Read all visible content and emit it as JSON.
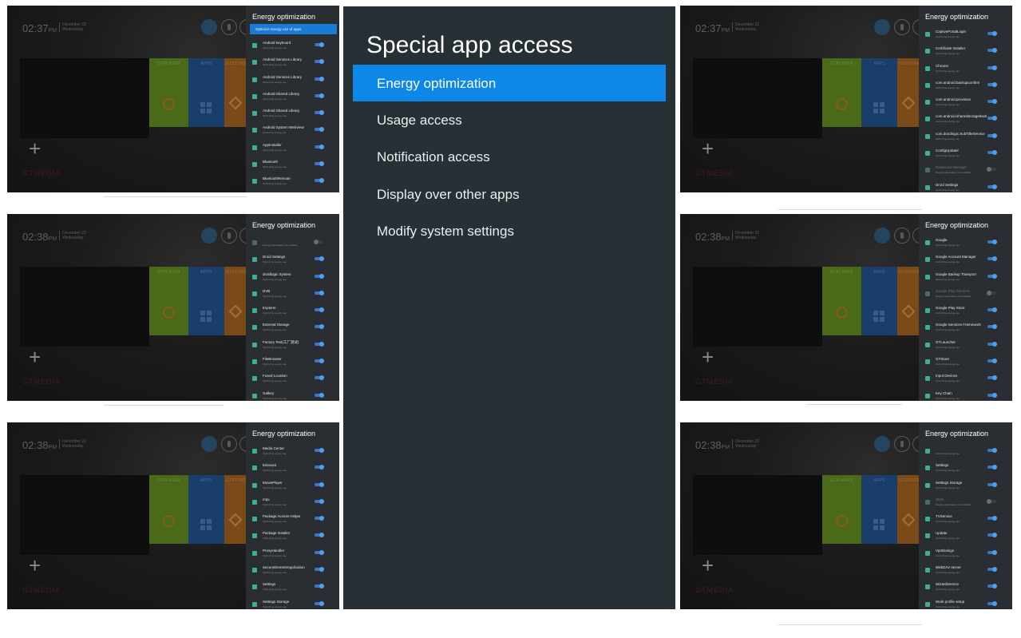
{
  "main": {
    "title": "Special app access",
    "items": [
      {
        "label": "Energy optimization",
        "selected": true
      },
      {
        "label": "Usage access",
        "selected": false
      },
      {
        "label": "Notification access",
        "selected": false
      },
      {
        "label": "Display over other apps",
        "selected": false
      },
      {
        "label": "Modify system settings",
        "selected": false
      }
    ]
  },
  "panel_title": "Energy optimization",
  "panel_header": "Optimize energy use of apps",
  "status_on": "Optimizing energy use",
  "status_off": "Energy optimization not available",
  "home": {
    "brand": "GTMEDIA",
    "tiles": [
      "GTPLAYER",
      "APPS",
      "GTSTORE"
    ],
    "date_line1": "December 22",
    "date_line2": "Wednesday"
  },
  "shots": [
    {
      "time": "02:37",
      "ampm": "PM",
      "apps": [
        "Android keyboard",
        "Android Services Library",
        "Android Services Library",
        "Android Shared Library",
        "Android Shared Library",
        "Android System WebView",
        "AppInstaller",
        "Bluetooth",
        "BluetoothRemote"
      ],
      "off": []
    },
    {
      "time": "02:37",
      "ampm": "PM",
      "apps": [
        "CaptivePortalLogin",
        "Certificate Installer",
        "Chrome",
        "com.android.backupconfirm",
        "com.android.provision",
        "com.android.sharedstoragebackup",
        "com.droidlogic.SubTitleService",
        "ConfigUpdater",
        "Download Manager",
        "Droid Settings"
      ],
      "off": [
        8
      ]
    },
    {
      "time": "02:38",
      "ampm": "PM",
      "apps": [
        "",
        "Droid Settings",
        "droidlogic System",
        "DVB",
        "Explorer",
        "External Storage",
        "Factory Test(工厂测试)",
        "FileBrowser",
        "Fused Location",
        "Gallery",
        "Google"
      ],
      "off": [
        0
      ]
    },
    {
      "time": "02:38",
      "ampm": "PM",
      "apps": [
        "Google",
        "Google Account Manager",
        "Google Backup Transport",
        "Google Play Services",
        "Google Play Store",
        "Google Services Framework",
        "GTLauncher",
        "GTStore",
        "Input Devices",
        "Key Chain"
      ],
      "off": [
        3
      ]
    },
    {
      "time": "02:38",
      "ampm": "PM",
      "apps": [
        "Media Center",
        "Miracast",
        "MoviePlayer",
        "mqv",
        "Package Access Helper",
        "Package installer",
        "ProxyHandler",
        "SecureElementApplication",
        "Settings",
        "Settings Storage"
      ],
      "off": []
    },
    {
      "time": "02:38",
      "ampm": "PM",
      "apps": [
        "",
        "Settings",
        "Settings Storage",
        "Shell",
        "TVService",
        "Update",
        "VpnDialogs",
        "WebDAV server",
        "WizardService",
        "Work profile setup"
      ],
      "off": [
        3
      ]
    }
  ]
}
